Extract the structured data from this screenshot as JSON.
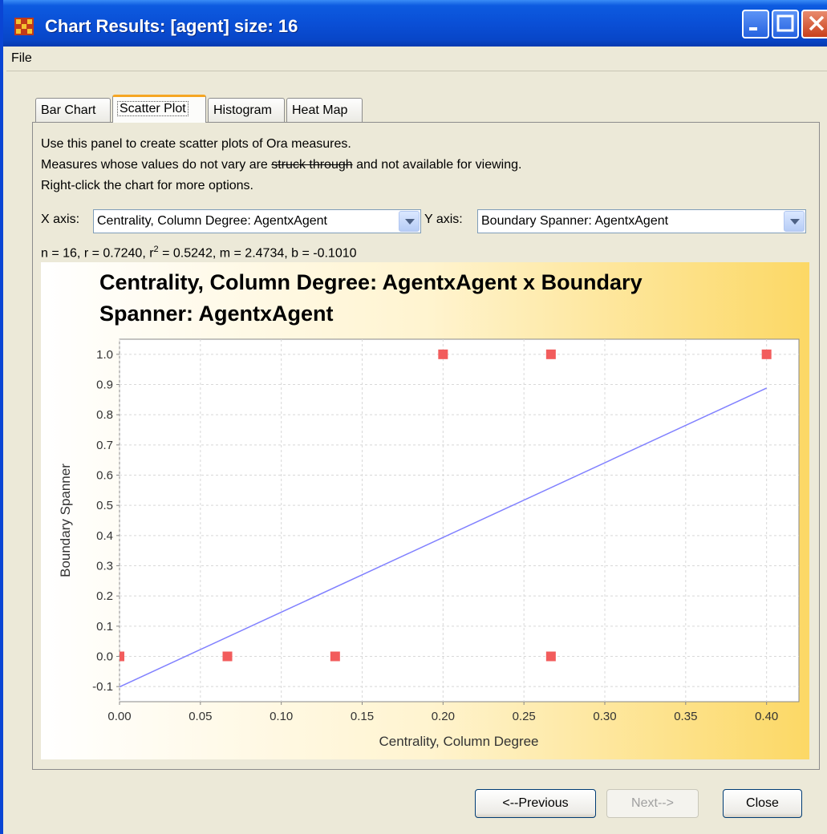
{
  "window": {
    "title": "Chart Results: [agent] size: 16",
    "controls": {
      "minimize": "minimize-icon",
      "maximize": "maximize-icon",
      "close": "close-icon"
    }
  },
  "menu": {
    "file": "File"
  },
  "tabs": [
    {
      "label": "Bar Chart",
      "active": false
    },
    {
      "label": "Scatter Plot",
      "active": true
    },
    {
      "label": "Histogram",
      "active": false
    },
    {
      "label": "Heat Map",
      "active": false
    }
  ],
  "description": {
    "line1": "Use this panel to create scatter plots of Ora measures.",
    "line2_before": "Measures whose values do not vary are ",
    "line2_struck": "struck through",
    "line2_after": " and not available for viewing.",
    "line3": "Right-click the chart for more options."
  },
  "controls": {
    "x_axis_label": "X axis:",
    "x_axis_value": "Centrality, Column Degree: AgentxAgent",
    "y_axis_label": "Y axis:",
    "y_axis_value": "Boundary Spanner: AgentxAgent"
  },
  "stats": {
    "prefix": "n = 16, r = 0.7240, r",
    "sup": "2",
    "suffix": " = 0.5242, m = 2.4734, b = -0.1010"
  },
  "chart_data": {
    "type": "scatter",
    "title_lines": [
      "Centrality, Column Degree: AgentxAgent x Boundary",
      "Spanner: AgentxAgent"
    ],
    "xlabel": "Centrality, Column Degree",
    "ylabel": "Boundary Spanner",
    "xlim": [
      0,
      0.42
    ],
    "ylim": [
      -0.15,
      1.05
    ],
    "xticks": [
      "0.00",
      "0.05",
      "0.10",
      "0.15",
      "0.20",
      "0.25",
      "0.30",
      "0.35",
      "0.40"
    ],
    "yticks": [
      "-0.1",
      "0.0",
      "0.1",
      "0.2",
      "0.3",
      "0.4",
      "0.5",
      "0.6",
      "0.7",
      "0.8",
      "0.9",
      "1.0"
    ],
    "grid": true,
    "points": [
      {
        "x": 0.0,
        "y": 0.0
      },
      {
        "x": 0.0667,
        "y": 0.0
      },
      {
        "x": 0.1333,
        "y": 0.0
      },
      {
        "x": 0.2,
        "y": 1.0
      },
      {
        "x": 0.2667,
        "y": 1.0
      },
      {
        "x": 0.2667,
        "y": 0.0
      },
      {
        "x": 0.4,
        "y": 1.0
      }
    ],
    "regression": {
      "slope": 2.4734,
      "intercept": -0.101,
      "x_range": [
        0,
        0.4
      ]
    },
    "colors": {
      "point": "#f25c5c",
      "line": "#8080ff",
      "grid": "#d8d8d8",
      "background_gradient": [
        "#ffffff",
        "#fcdc6e"
      ]
    }
  },
  "buttons": {
    "previous": "<--Previous",
    "next": "Next-->",
    "close": "Close"
  }
}
